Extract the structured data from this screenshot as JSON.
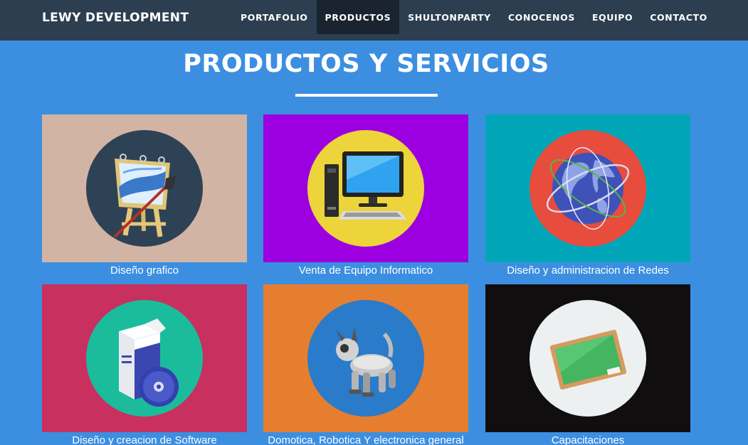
{
  "brand": "LEWY DEVELOPMENT",
  "nav": {
    "items": [
      {
        "label": "PORTAFOLIO",
        "active": false
      },
      {
        "label": "PRODUCTOS",
        "active": true
      },
      {
        "label": "SHULTONPARTY",
        "active": false
      },
      {
        "label": "CONOCENOS",
        "active": false
      },
      {
        "label": "EQUIPO",
        "active": false
      },
      {
        "label": "CONTACTO",
        "active": false
      }
    ]
  },
  "section": {
    "title": "PRODUCTOS Y SERVICIOS"
  },
  "products": [
    {
      "label": "Diseño grafico",
      "icon": "billboard-paintbrush-icon",
      "bg": "#d1b4a4",
      "circle": "#2e4255"
    },
    {
      "label": "Venta de Equipo Informatico",
      "icon": "desktop-computer-icon",
      "bg": "#9c00e0",
      "circle": "#ecd43a"
    },
    {
      "label": "Diseño y administracion de Redes",
      "icon": "globe-network-icon",
      "bg": "#00a6b8",
      "circle": "#e74c3c"
    },
    {
      "label": "Diseño y creacion de Software",
      "icon": "software-box-icon",
      "bg": "#c8305f",
      "circle": "#1abc9c"
    },
    {
      "label": "Domotica, Robotica Y electronica general",
      "icon": "robot-dog-icon",
      "bg": "#e67e30",
      "circle": "#2a7bca"
    },
    {
      "label": "Capacitaciones",
      "icon": "chalkboard-icon",
      "bg": "#110e10",
      "circle": "#ecf0f1"
    }
  ]
}
